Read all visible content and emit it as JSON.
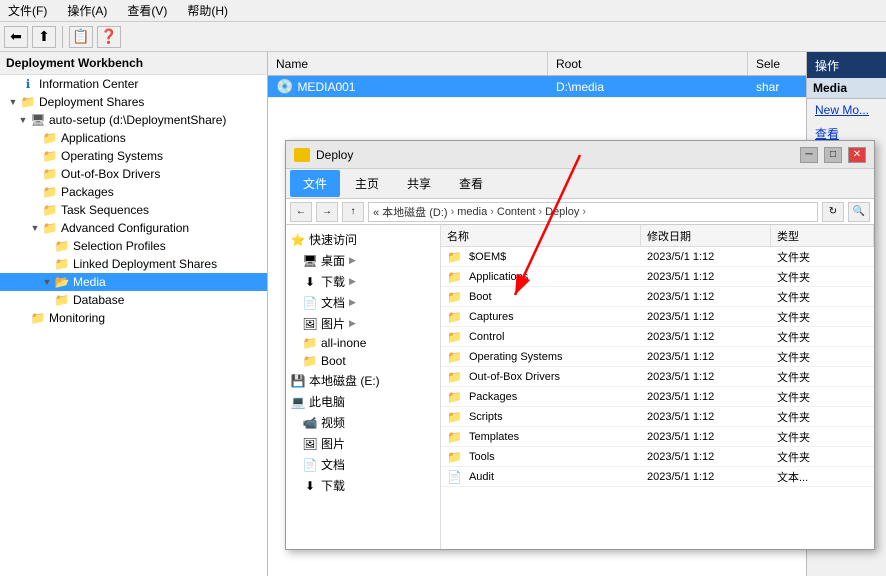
{
  "app": {
    "title": "Deployment Workbench"
  },
  "menubar": {
    "items": [
      "文件(F)",
      "操作(A)",
      "查看(V)",
      "帮助(H)"
    ]
  },
  "toolbar": {
    "buttons": [
      "⬅",
      "⬆",
      "📋",
      "❓"
    ]
  },
  "tree": {
    "header": "Deployment Workbench",
    "items": [
      {
        "label": "Information Center",
        "level": 1,
        "icon": "info",
        "arrow": ""
      },
      {
        "label": "Deployment Shares",
        "level": 1,
        "icon": "folder",
        "arrow": "▼"
      },
      {
        "label": "auto-setup (d:\\DeploymentShare)",
        "level": 2,
        "icon": "computer",
        "arrow": "▼"
      },
      {
        "label": "Applications",
        "level": 3,
        "icon": "folder",
        "arrow": ""
      },
      {
        "label": "Operating Systems",
        "level": 3,
        "icon": "folder",
        "arrow": ""
      },
      {
        "label": "Out-of-Box Drivers",
        "level": 3,
        "icon": "folder",
        "arrow": ""
      },
      {
        "label": "Packages",
        "level": 3,
        "icon": "folder",
        "arrow": ""
      },
      {
        "label": "Task Sequences",
        "level": 3,
        "icon": "folder",
        "arrow": ""
      },
      {
        "label": "Advanced Configuration",
        "level": 3,
        "icon": "folder",
        "arrow": "▼"
      },
      {
        "label": "Selection Profiles",
        "level": 4,
        "icon": "folder",
        "arrow": ""
      },
      {
        "label": "Linked Deployment Shares",
        "level": 4,
        "icon": "folder",
        "arrow": ""
      },
      {
        "label": "Media",
        "level": 4,
        "icon": "folder-open",
        "arrow": "▼",
        "selected": true
      },
      {
        "label": "Database",
        "level": 4,
        "icon": "folder",
        "arrow": ""
      },
      {
        "label": "Monitoring",
        "level": 2,
        "icon": "folder",
        "arrow": ""
      }
    ]
  },
  "right_panel": {
    "columns": [
      "Name",
      "Root",
      "Sele",
      "操作"
    ],
    "rows": [
      {
        "name": "MEDIA001",
        "root": "D:\\media",
        "sele": "shar"
      }
    ],
    "action_panel": {
      "title": "操作",
      "section": "Media",
      "items": [
        "New Mo...",
        "查看"
      ]
    }
  },
  "file_explorer": {
    "title": "Deploy",
    "toolbar_tabs": [
      "文件",
      "主页",
      "共享",
      "查看"
    ],
    "active_tab": "文件",
    "address": [
      "本地磁盘 (D:)",
      "media",
      "Content",
      "Deploy"
    ],
    "left_tree": [
      {
        "label": "快速访问",
        "level": 0,
        "icon": "⭐",
        "arrow": "▼"
      },
      {
        "label": "桌面",
        "level": 1,
        "icon": "🖥",
        "arrow": ""
      },
      {
        "label": "下载",
        "level": 1,
        "icon": "⬇",
        "arrow": ""
      },
      {
        "label": "文档",
        "level": 1,
        "icon": "📄",
        "arrow": ""
      },
      {
        "label": "图片",
        "level": 1,
        "icon": "🖼",
        "arrow": ""
      },
      {
        "label": "all-inone",
        "level": 1,
        "icon": "📁",
        "arrow": ""
      },
      {
        "label": "Boot",
        "level": 1,
        "icon": "📁",
        "arrow": ""
      },
      {
        "label": "本地磁盘 (E:)",
        "level": 0,
        "icon": "💾",
        "arrow": ""
      },
      {
        "label": "此电脑",
        "level": 0,
        "icon": "💻",
        "arrow": "▼"
      },
      {
        "label": "视频",
        "level": 1,
        "icon": "📹",
        "arrow": ""
      },
      {
        "label": "图片",
        "level": 1,
        "icon": "🖼",
        "arrow": ""
      },
      {
        "label": "文档",
        "level": 1,
        "icon": "📄",
        "arrow": ""
      },
      {
        "label": "下载",
        "level": 1,
        "icon": "⬇",
        "arrow": ""
      }
    ],
    "columns": [
      "名称",
      "修改日期",
      "类型"
    ],
    "files": [
      {
        "name": "$OEM$",
        "date": "2023/5/1 1:12",
        "type": "文件夹"
      },
      {
        "name": "Applications",
        "date": "2023/5/1 1:12",
        "type": "文件夹"
      },
      {
        "name": "Boot",
        "date": "2023/5/1 1:12",
        "type": "文件夹"
      },
      {
        "name": "Captures",
        "date": "2023/5/1 1:12",
        "type": "文件夹"
      },
      {
        "name": "Control",
        "date": "2023/5/1 1:12",
        "type": "文件夹"
      },
      {
        "name": "Operating Systems",
        "date": "2023/5/1 1:12",
        "type": "文件夹"
      },
      {
        "name": "Out-of-Box Drivers",
        "date": "2023/5/1 1:12",
        "type": "文件夹"
      },
      {
        "name": "Packages",
        "date": "2023/5/1 1:12",
        "type": "文件夹"
      },
      {
        "name": "Scripts",
        "date": "2023/5/1 1:12",
        "type": "文件夹"
      },
      {
        "name": "Templates",
        "date": "2023/5/1 1:12",
        "type": "文件夹"
      },
      {
        "name": "Tools",
        "date": "2023/5/1 1:12",
        "type": "文件夹"
      },
      {
        "name": "Audit",
        "date": "2023/5/1 1:12",
        "type": "文本..."
      }
    ]
  },
  "colors": {
    "accent_blue": "#3399ff",
    "folder_yellow": "#f0c000",
    "action_header_bg": "#1a3a6b",
    "selected_bg": "#3399ff",
    "nav_bg": "#2a5f9e"
  }
}
